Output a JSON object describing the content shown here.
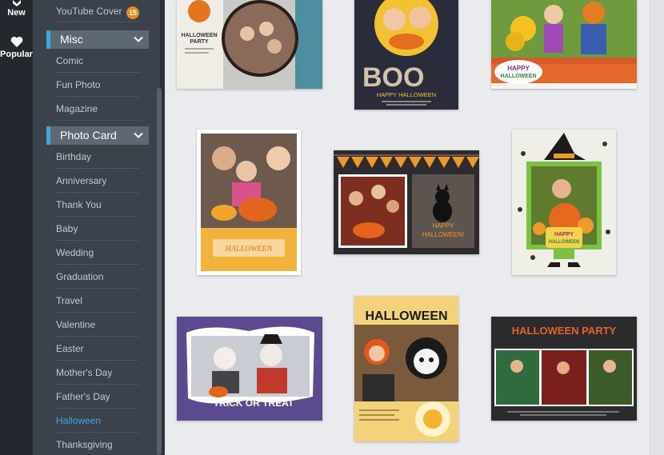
{
  "rail": {
    "new_label": "New",
    "popular_label": "Popular"
  },
  "sidebar": {
    "top_item": {
      "label": "YouTube Cover",
      "badge": "15"
    },
    "sections": [
      {
        "title": "Misc",
        "items": [
          {
            "label": "Comic"
          },
          {
            "label": "Fun Photo"
          },
          {
            "label": "Magazine"
          }
        ]
      },
      {
        "title": "Photo Card",
        "items": [
          {
            "label": "Birthday"
          },
          {
            "label": "Anniversary"
          },
          {
            "label": "Thank You"
          },
          {
            "label": "Baby"
          },
          {
            "label": "Wedding"
          },
          {
            "label": "Graduation"
          },
          {
            "label": "Travel"
          },
          {
            "label": "Valentine"
          },
          {
            "label": "Easter"
          },
          {
            "label": "Mother's Day"
          },
          {
            "label": "Father's Day"
          },
          {
            "label": "Halloween"
          },
          {
            "label": "Thanksgiving"
          }
        ]
      }
    ],
    "active_item": "Halloween"
  },
  "templates": [
    {
      "name": "halloween-party-template",
      "text": [
        "HALLOWEEN",
        "PARTY"
      ]
    },
    {
      "name": "boo-template",
      "text": [
        "BOO",
        "HAPPY HALLOWEEN"
      ]
    },
    {
      "name": "happy-halloween-pumpkin-patch-template",
      "text": [
        "HAPPY",
        "HALLOWEEN"
      ]
    },
    {
      "name": "family-pumpkin-template",
      "text": [
        "HALLOWEEN"
      ]
    },
    {
      "name": "bunting-cat-template",
      "text": [
        "HAPPY",
        "HALLOWEEN!"
      ]
    },
    {
      "name": "witch-hat-template",
      "text": [
        "HAPPY",
        "HALLOWEEN"
      ]
    },
    {
      "name": "trick-or-treat-template",
      "text": [
        "TRICK OR TREAT"
      ]
    },
    {
      "name": "halloween-skull-template",
      "text": [
        "HALLOWEEN"
      ]
    },
    {
      "name": "halloween-party-strip-template",
      "text": [
        "HALLOWEEN PARTY"
      ]
    }
  ],
  "colors": {
    "accent": "#3aa9d8",
    "badge": "#e68a1f",
    "rail_bg": "#23272e",
    "panel_bg": "#3b424c"
  }
}
